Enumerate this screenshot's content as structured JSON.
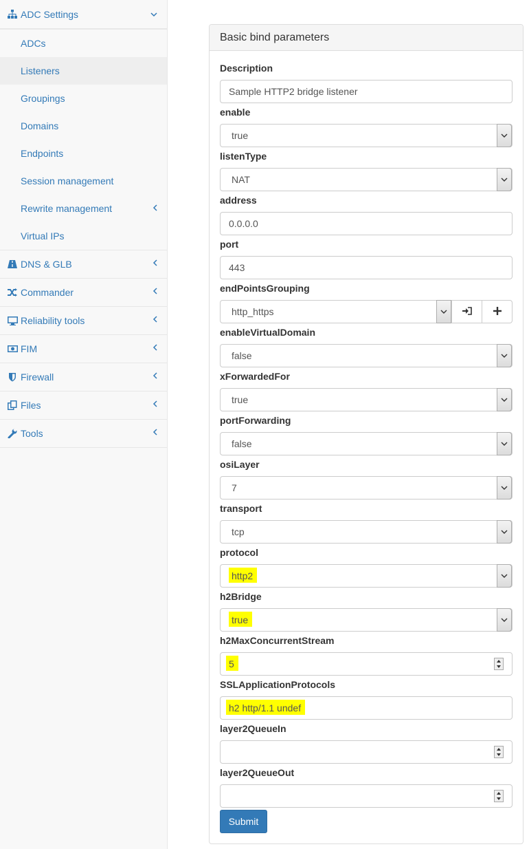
{
  "sidebar": {
    "adc_settings": {
      "label": "ADC Settings",
      "items": [
        {
          "label": "ADCs"
        },
        {
          "label": "Listeners"
        },
        {
          "label": "Groupings"
        },
        {
          "label": "Domains"
        },
        {
          "label": "Endpoints"
        },
        {
          "label": "Session management"
        },
        {
          "label": "Rewrite management"
        },
        {
          "label": "Virtual IPs"
        }
      ]
    },
    "groups": [
      {
        "label": "DNS & GLB",
        "icon": "road-icon"
      },
      {
        "label": "Commander",
        "icon": "random-icon"
      },
      {
        "label": "Reliability tools",
        "icon": "monitor-icon"
      },
      {
        "label": "FIM",
        "icon": "fim-icon"
      },
      {
        "label": "Firewall",
        "icon": "shield-icon"
      },
      {
        "label": "Files",
        "icon": "files-icon"
      },
      {
        "label": "Tools",
        "icon": "wrench-icon"
      }
    ],
    "active_item": "Listeners"
  },
  "panel": {
    "title": "Basic bind parameters",
    "fields": {
      "description": {
        "label": "Description",
        "value": "Sample HTTP2 bridge listener"
      },
      "enable": {
        "label": "enable",
        "value": "true"
      },
      "listenType": {
        "label": "listenType",
        "value": "NAT"
      },
      "address": {
        "label": "address",
        "value": "0.0.0.0"
      },
      "port": {
        "label": "port",
        "value": "443"
      },
      "endPointsGrouping": {
        "label": "endPointsGrouping",
        "value": "http_https"
      },
      "enableVirtualDomain": {
        "label": "enableVirtualDomain",
        "value": "false"
      },
      "xForwardedFor": {
        "label": "xForwardedFor",
        "value": "true"
      },
      "portForwarding": {
        "label": "portForwarding",
        "value": "false"
      },
      "osiLayer": {
        "label": "osiLayer",
        "value": "7"
      },
      "transport": {
        "label": "transport",
        "value": "tcp"
      },
      "protocol": {
        "label": "protocol",
        "value": "http2"
      },
      "h2Bridge": {
        "label": "h2Bridge",
        "value": "true"
      },
      "h2MaxConcurrentStream": {
        "label": "h2MaxConcurrentStream",
        "value": "5"
      },
      "SSLApplicationProtocols": {
        "label": "SSLApplicationProtocols",
        "value": "h2 http/1.1 undef"
      },
      "layer2QueueIn": {
        "label": "layer2QueueIn",
        "value": ""
      },
      "layer2QueueOut": {
        "label": "layer2QueueOut",
        "value": ""
      }
    },
    "submit_label": "Submit",
    "highlight_color": "#ffff00"
  },
  "colors": {
    "link": "#337ab7",
    "sidebar_bg": "#f8f8f8",
    "active_bg": "#eeeeee",
    "primary_button": "#337ab7"
  }
}
